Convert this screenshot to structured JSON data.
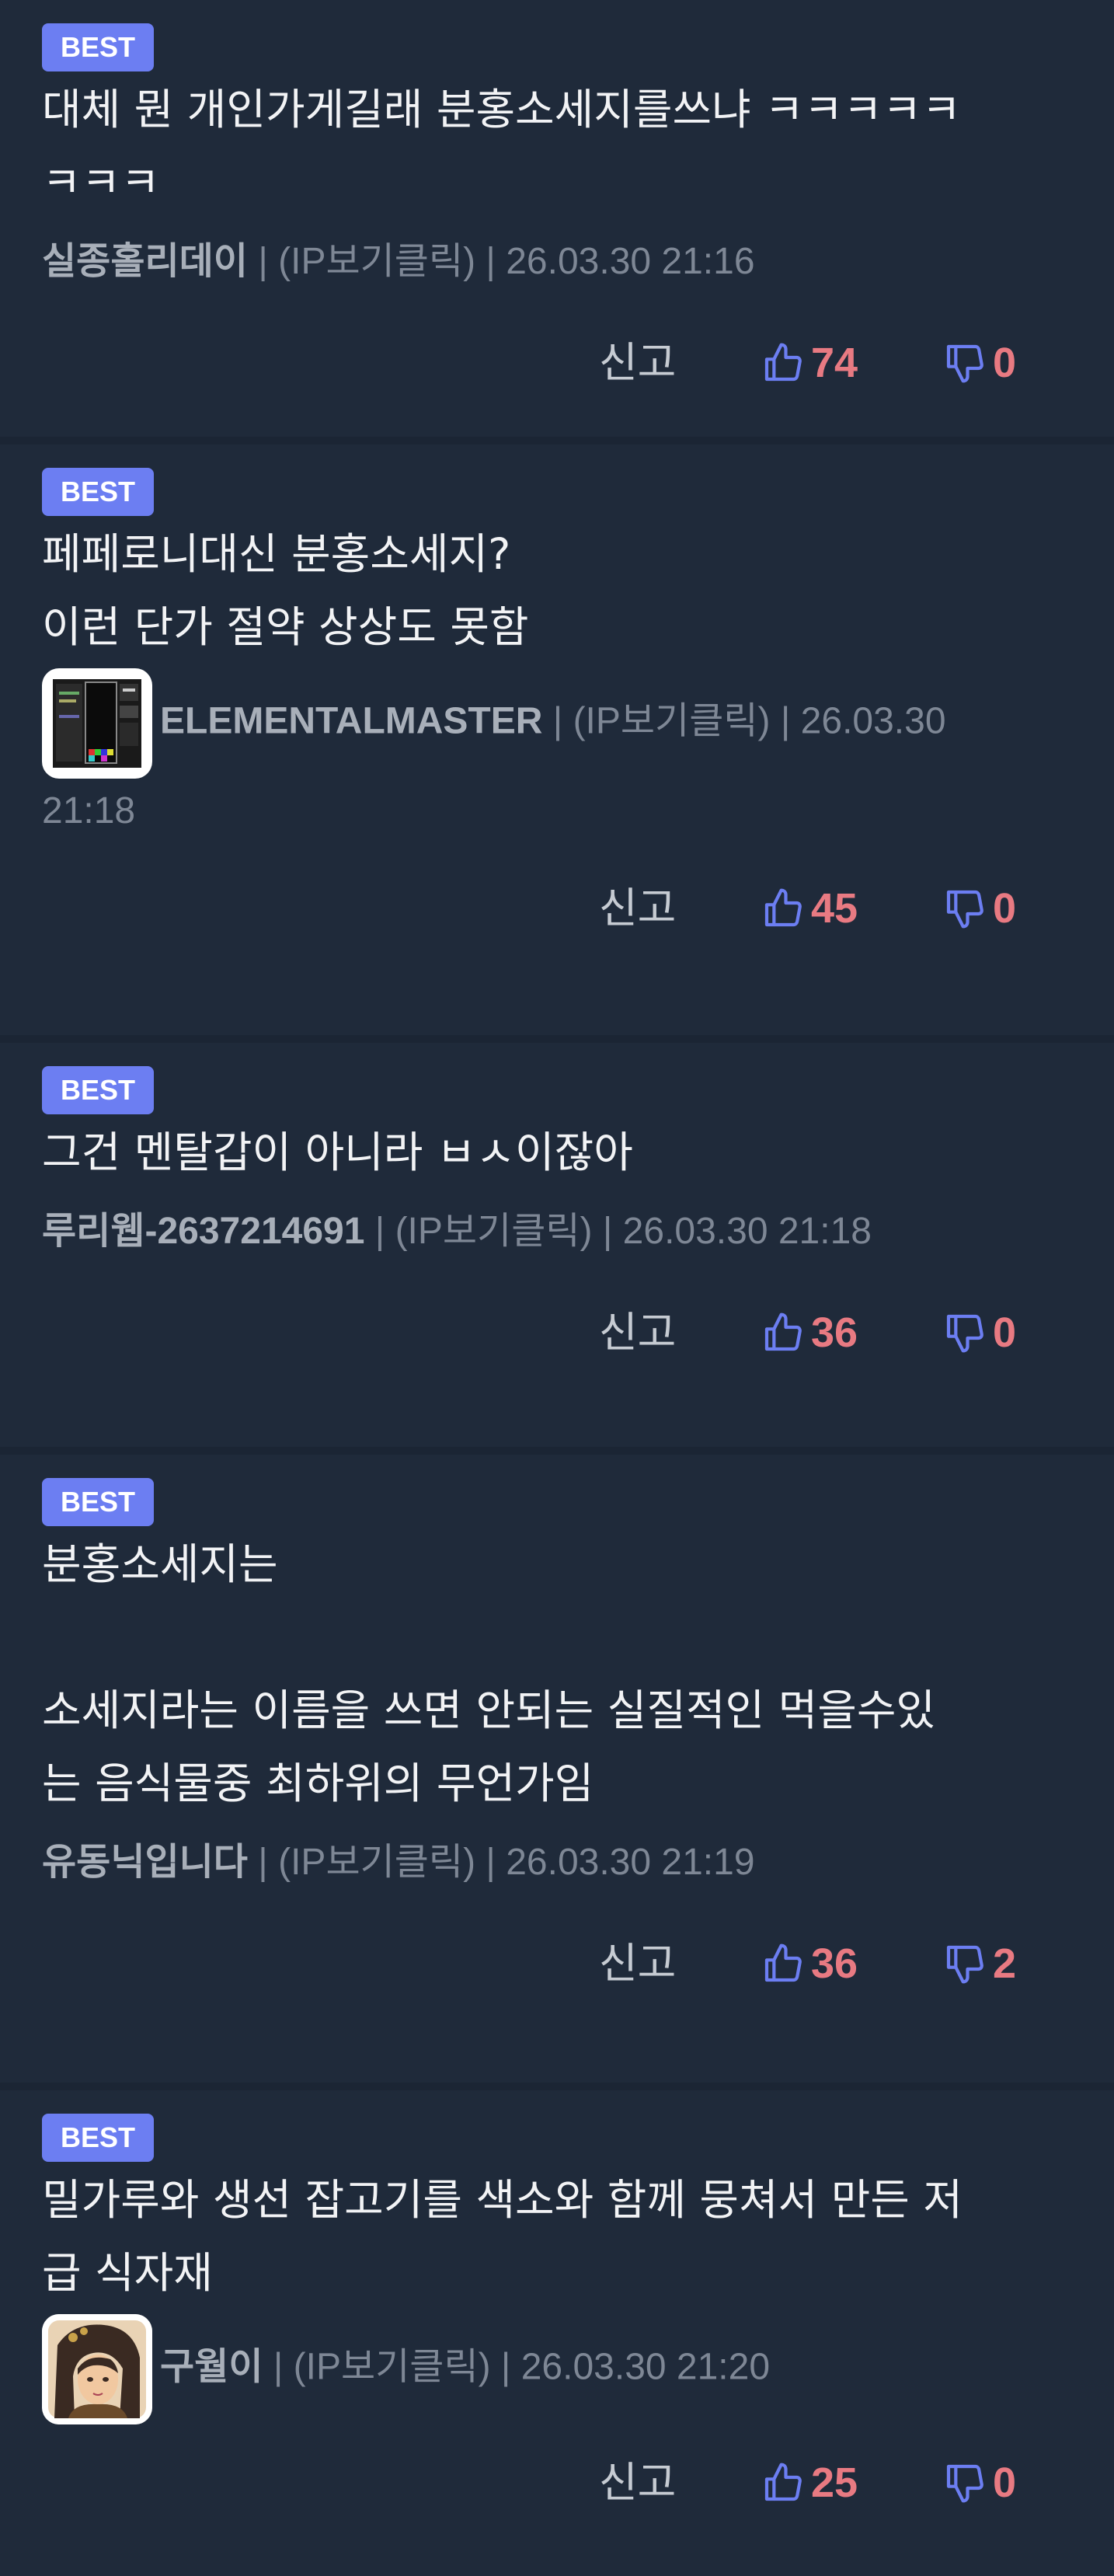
{
  "colors": {
    "background": "#1f2a3a",
    "badge": "#6c7ef2",
    "vote_count": "#e87a82",
    "thumb_icon": "#6c7ef2"
  },
  "comments": [
    {
      "badge": "BEST",
      "body": "대체 뭔 개인가게길래 분홍소세지를쓰냐 ㅋㅋㅋㅋㅋ\nㅋㅋㅋ",
      "author": "실종홀리데이",
      "ip": "(IP보기클릭)",
      "date": "26.03.30 21:16",
      "has_avatar": false,
      "report": "신고",
      "likes": "74",
      "dislikes": "0"
    },
    {
      "badge": "BEST",
      "body": "페페로니대신 분홍소세지?\n이런 단가 절약 상상도 못함",
      "author": "ELEMENTALMASTER",
      "ip": "(IP보기클릭)",
      "date": "26.03.30",
      "date_wrap": "21:18",
      "has_avatar": true,
      "avatar_icon": "tetris-game-avatar-icon",
      "report": "신고",
      "likes": "45",
      "dislikes": "0"
    },
    {
      "badge": "BEST",
      "body": "그건 멘탈갑이 아니라 ㅂㅅ이잖아",
      "author": "루리웹-2637214691",
      "ip": "(IP보기클릭)",
      "date": "26.03.30 21:18",
      "has_avatar": false,
      "report": "신고",
      "likes": "36",
      "dislikes": "0"
    },
    {
      "badge": "BEST",
      "body": "분홍소세지는\n\n소세지라는 이름을 쓰면 안되는 실질적인 먹을수있\n는 음식물중 최하위의 무언가임",
      "author": "유동닉입니다",
      "ip": "(IP보기클릭)",
      "date": "26.03.30 21:19",
      "has_avatar": false,
      "report": "신고",
      "likes": "36",
      "dislikes": "2"
    },
    {
      "badge": "BEST",
      "body": "밀가루와 생선 잡고기를 색소와 함께 뭉쳐서 만든 저\n급 식자재",
      "author": "구월이",
      "ip": "(IP보기클릭)",
      "date": "26.03.30 21:20",
      "has_avatar": true,
      "avatar_icon": "anime-character-avatar-icon",
      "report": "신고",
      "likes": "25",
      "dislikes": "0"
    }
  ]
}
